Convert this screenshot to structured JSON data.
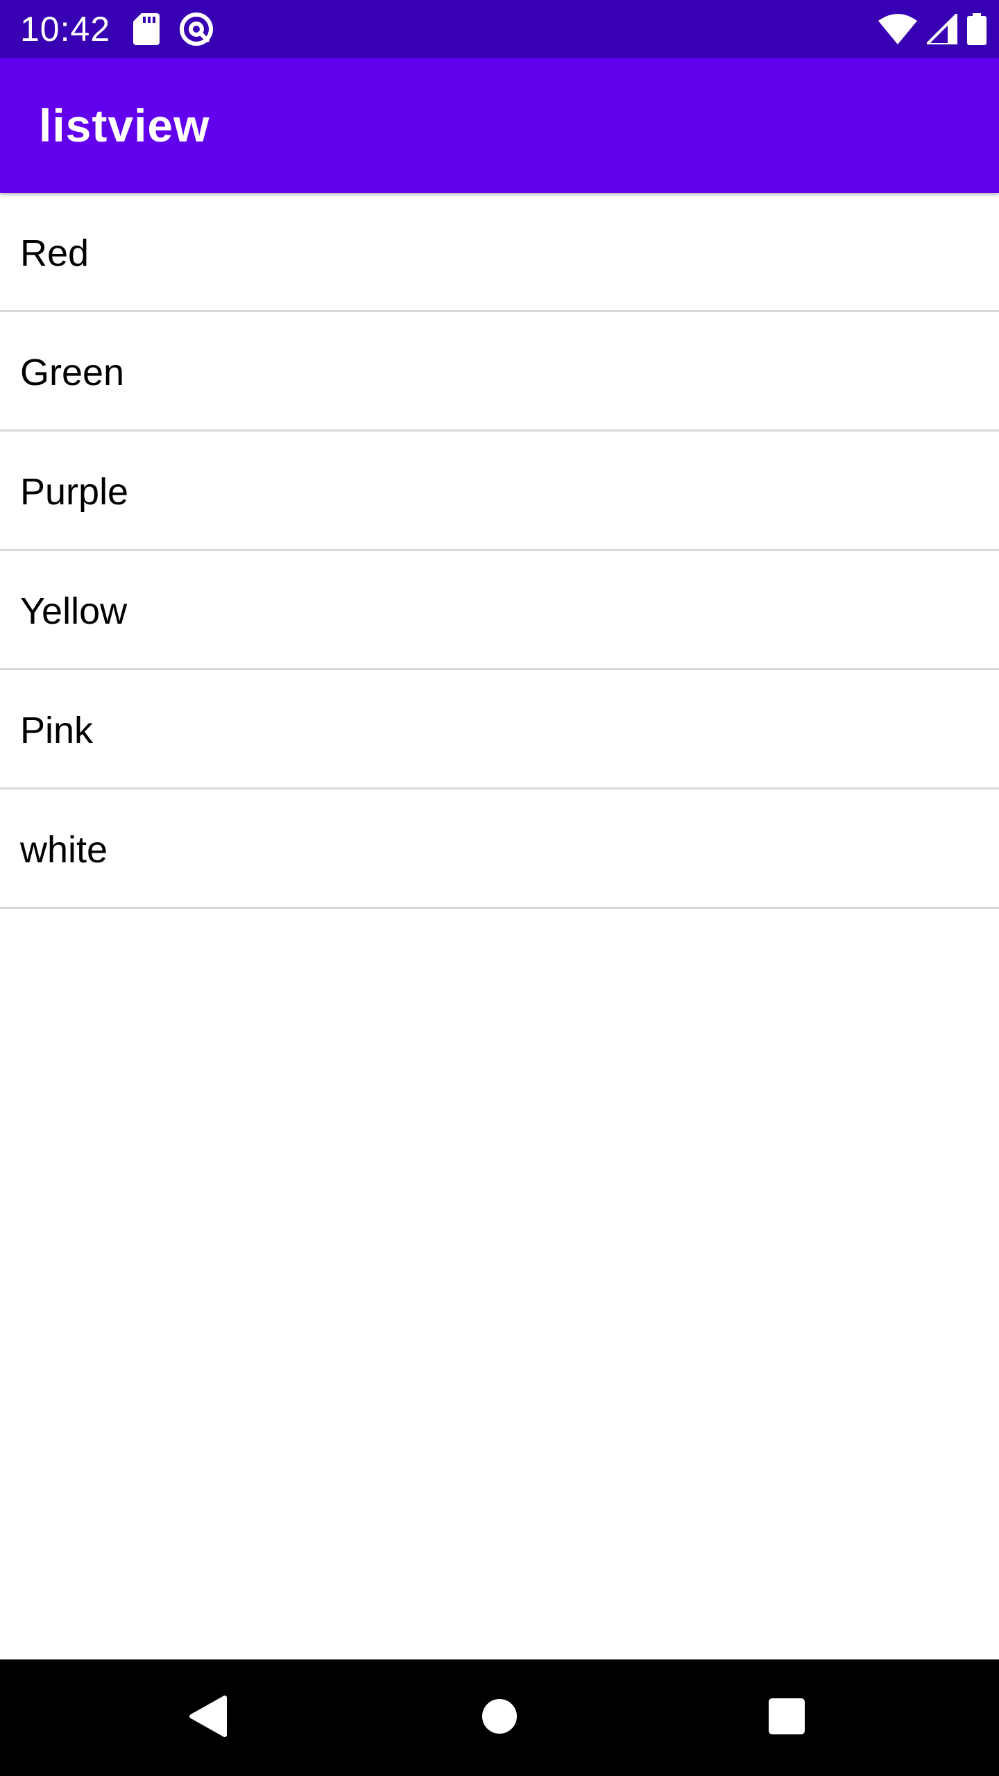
{
  "status_bar": {
    "time": "10:42",
    "background": "#3700b3",
    "left_icons": [
      "sd-card-icon",
      "at-sign-icon"
    ],
    "right_icons": [
      "wifi-icon",
      "cell-signal-icon",
      "battery-icon"
    ]
  },
  "app_bar": {
    "title": "listview",
    "background": "#6200ee"
  },
  "list": {
    "items": [
      {
        "label": "Red"
      },
      {
        "label": "Green"
      },
      {
        "label": "Purple"
      },
      {
        "label": "Yellow"
      },
      {
        "label": "Pink"
      },
      {
        "label": "white"
      }
    ],
    "divider_color": "#d9d9d9"
  },
  "nav_bar": {
    "buttons": [
      "back-icon",
      "home-icon",
      "recents-icon"
    ]
  }
}
